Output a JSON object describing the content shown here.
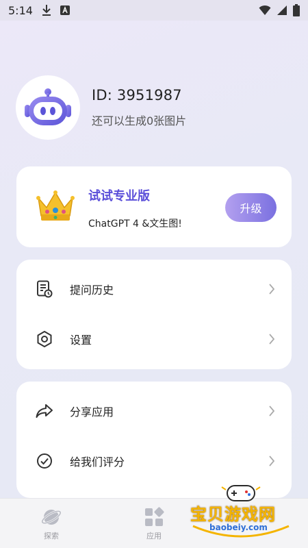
{
  "status_bar": {
    "time": "5:14",
    "left_icons": [
      "download-icon",
      "a-badge-icon"
    ],
    "right_icons": [
      "wifi-icon",
      "signal-icon",
      "battery-icon"
    ]
  },
  "profile": {
    "id_text": "ID: 3951987",
    "remaining_text": "还可以生成0张图片",
    "avatar_icon": "robot-icon"
  },
  "pro_card": {
    "title": "试试专业版",
    "subtitle": "ChatGPT 4 &文生图!",
    "upgrade_label": "升级",
    "icon": "crown-icon"
  },
  "menu_group_1": [
    {
      "label": "提问历史",
      "icon": "history-doc-icon"
    },
    {
      "label": "设置",
      "icon": "settings-hexagon-icon"
    }
  ],
  "menu_group_2": [
    {
      "label": "分享应用",
      "icon": "share-arrow-icon"
    },
    {
      "label": "给我们评分",
      "icon": "check-circle-icon"
    }
  ],
  "bottom_nav": [
    {
      "label": "探索",
      "icon": "planet-icon"
    },
    {
      "label": "应用",
      "icon": "apps-grid-icon"
    }
  ],
  "watermark": {
    "title": "宝贝游戏网",
    "url": "baobeiy.com"
  },
  "colors": {
    "accent": "#5b4fd9",
    "button_gradient_start": "#b3a0ef",
    "button_gradient_end": "#7a70e0"
  }
}
